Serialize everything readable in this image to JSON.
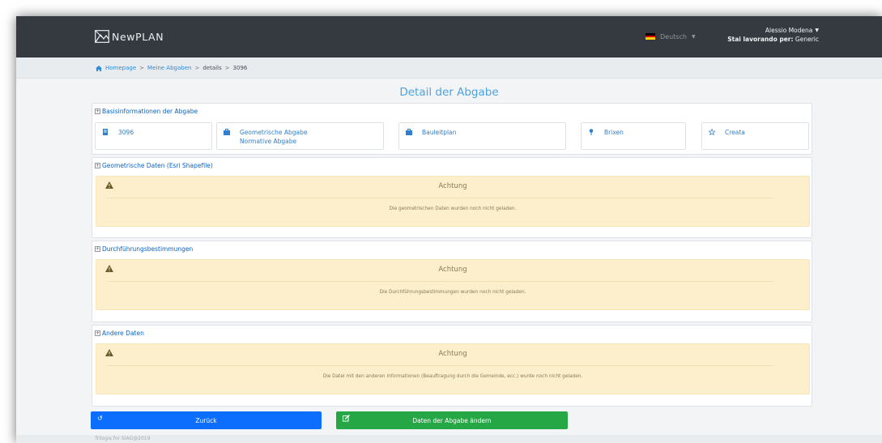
{
  "navbar": {
    "brand": "NewPLAN",
    "language": "Deutsch",
    "user_name": "Alessio Modena",
    "work_label": "Stai lavorando per:",
    "work_value": "Generic",
    "flag_colors": [
      "#000000",
      "#dd0000",
      "#ffce00"
    ]
  },
  "breadcrumb": {
    "home": "Homepage",
    "deliveries": "Meine Abgaben",
    "details": "details",
    "id": "3096",
    "separator": ">"
  },
  "page": {
    "title": "Detail der Abgabe"
  },
  "basis": {
    "header": "Basisinformationen der Abgabe",
    "boxes": [
      {
        "icon": "document-icon",
        "text": "3096"
      },
      {
        "icon": "briefcase-icon",
        "text": "Geometrische Abgabe",
        "text2": "Normative Abgabe"
      },
      {
        "icon": "briefcase-icon",
        "text": "Bauleitplan"
      },
      {
        "icon": "map-pin-icon",
        "text": "Brixen"
      },
      {
        "icon": "star-icon",
        "text": "Creata"
      }
    ]
  },
  "geo": {
    "header": "Geometrische Daten (Esri Shapefile)",
    "alert_title": "Achtung",
    "alert_msg": "Die geometrischen Daten wurden noch nicht geladen."
  },
  "impl": {
    "header": "Durchführungsbestimmungen",
    "alert_title": "Achtung",
    "alert_msg": "Die Durchführungsbestimmungen wurden noch nicht geladen."
  },
  "other": {
    "header": "Andere Daten",
    "alert_title": "Achtung",
    "alert_msg": "Die Datei mit den anderen Informationen (Beauftragung durch die Gemeinde, ecc.) wurde noch nicht geladen."
  },
  "buttons": {
    "back": "Zurück",
    "edit": "Daten der Abgabe ändern"
  },
  "footer": {
    "text": "Trilogis for SIAG@2019"
  },
  "colors": {
    "navbar": "#343a40",
    "accent": "#0d6efd",
    "success": "#26a745",
    "warning_bg": "#fdefcc"
  }
}
